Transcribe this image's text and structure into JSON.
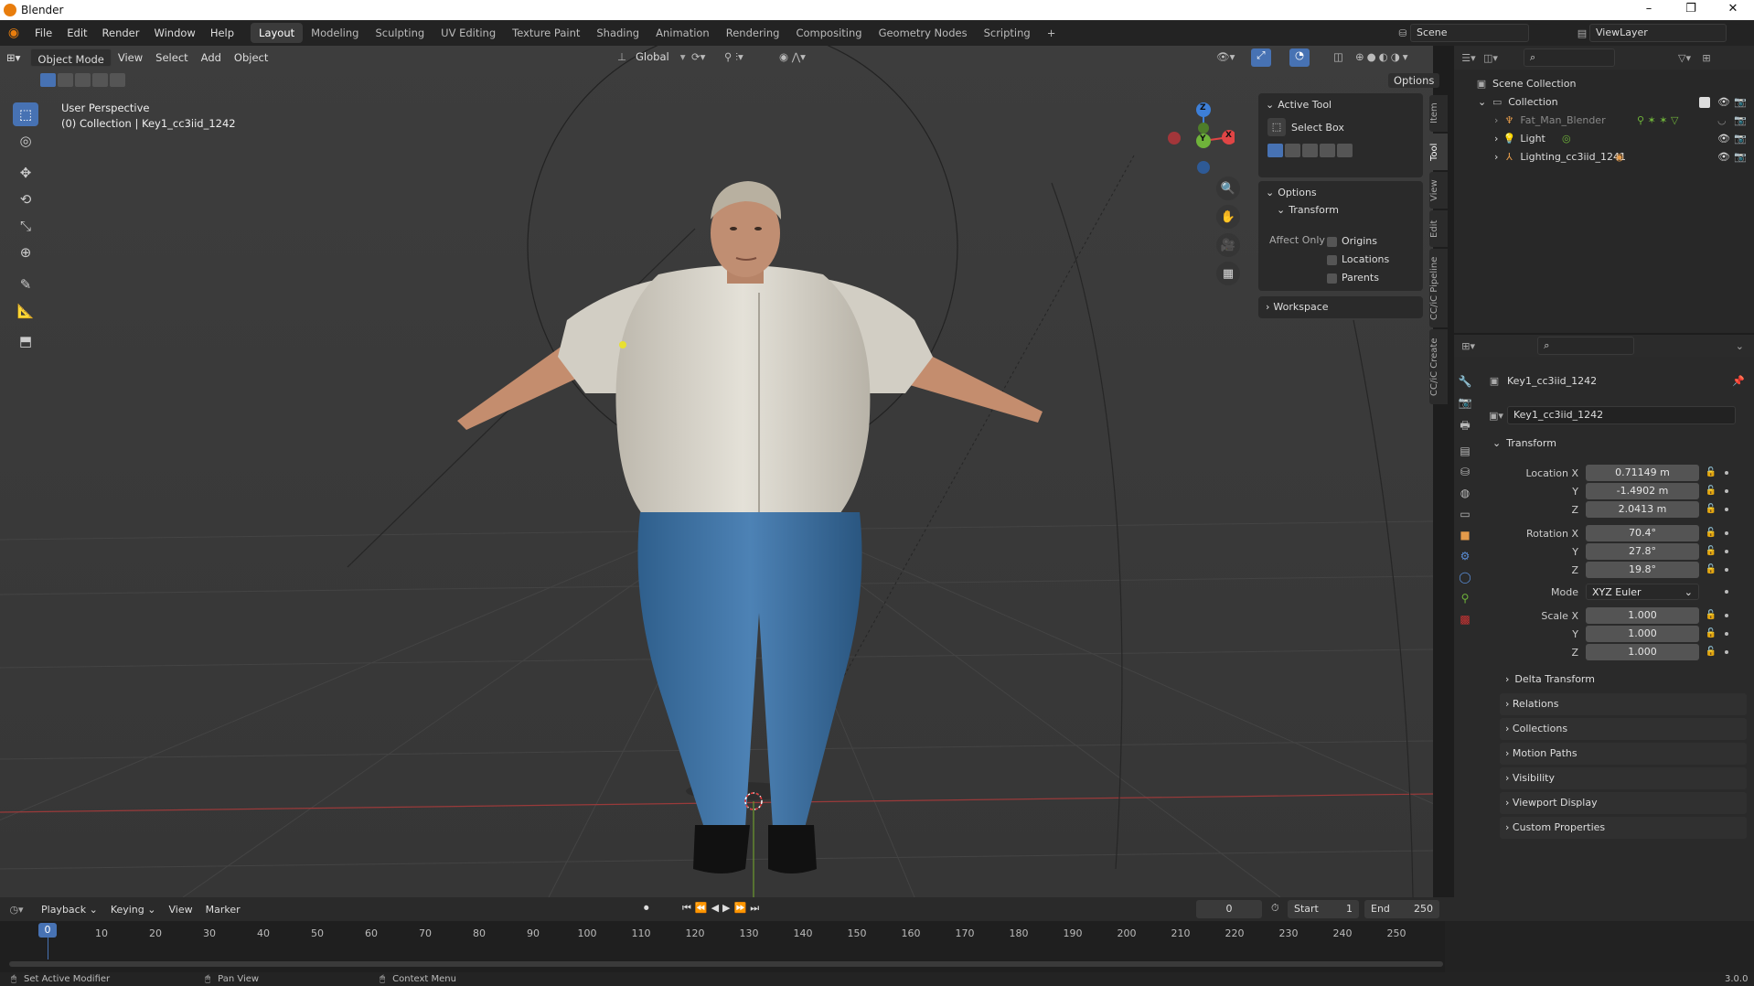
{
  "window": {
    "title": "Blender",
    "minimize": "–",
    "maximize": "❐",
    "close": "✕"
  },
  "menus": [
    "File",
    "Edit",
    "Render",
    "Window",
    "Help"
  ],
  "workspaces": [
    "Layout",
    "Modeling",
    "Sculpting",
    "UV Editing",
    "Texture Paint",
    "Shading",
    "Animation",
    "Rendering",
    "Compositing",
    "Geometry Nodes",
    "Scripting",
    "+"
  ],
  "scene": {
    "name": "Scene",
    "view_layer": "ViewLayer"
  },
  "viewport_header": {
    "mode": "Object Mode",
    "menus": [
      "View",
      "Select",
      "Add",
      "Object"
    ],
    "orientation": "Global",
    "options": "Options"
  },
  "viewport": {
    "perspective": "User Perspective",
    "collection_info": "(0) Collection | Key1_cc3iid_1242",
    "gizmo": {
      "x": "X",
      "y": "Y",
      "z": "Z",
      "x_color": "#e04545",
      "y_color": "#6fb33a",
      "z_color": "#3d7fd8"
    }
  },
  "tools": [
    "select-box",
    "cursor",
    "move",
    "rotate",
    "scale",
    "transform",
    "annotate",
    "measure",
    "add-cube"
  ],
  "n_panel": {
    "active_tool_title": "Active Tool",
    "tool_name": "Select Box",
    "options_title": "Options",
    "transform_title": "Transform",
    "affect_only": "Affect Only",
    "checks": [
      "Origins",
      "Locations",
      "Parents"
    ],
    "workspace_title": "Workspace",
    "tabs": [
      "Item",
      "Tool",
      "View",
      "Edit",
      "CC/iC Pipeline",
      "CC/iC Create"
    ]
  },
  "outliner": {
    "root": "Scene Collection",
    "collection": "Collection",
    "items": [
      "Fat_Man_Blender",
      "Light",
      "Lighting_cc3iid_1241"
    ]
  },
  "properties": {
    "object_name": "Key1_cc3iid_1242",
    "data_name": "Key1_cc3iid_1242",
    "transform_title": "Transform",
    "location": {
      "label": "Location X",
      "x": "0.71149 m",
      "y": "-1.4902 m",
      "z": "2.0413 m"
    },
    "rotation": {
      "label": "Rotation X",
      "x": "70.4°",
      "y": "27.8°",
      "z": "19.8°"
    },
    "mode_label": "Mode",
    "mode": "XYZ Euler",
    "scale": {
      "label": "Scale X",
      "x": "1.000",
      "y": "1.000",
      "z": "1.000"
    },
    "axis_y": "Y",
    "axis_z": "Z",
    "delta": "Delta Transform",
    "panels": [
      "Relations",
      "Collections",
      "Motion Paths",
      "Visibility",
      "Viewport Display",
      "Custom Properties"
    ]
  },
  "timeline": {
    "menus": [
      "Playback",
      "Keying",
      "View",
      "Marker"
    ],
    "current_frame": "0",
    "start_label": "Start",
    "start": "1",
    "end_label": "End",
    "end": "250",
    "ticks": [
      "10",
      "20",
      "30",
      "40",
      "50",
      "60",
      "70",
      "80",
      "90",
      "100",
      "110",
      "120",
      "130",
      "140",
      "150",
      "160",
      "170",
      "180",
      "190",
      "200",
      "210",
      "220",
      "230",
      "240",
      "250"
    ],
    "playhead": "0"
  },
  "status": {
    "left": "Set Active Modifier",
    "middle": "Pan View",
    "right": "Context Menu",
    "version": "3.0.0"
  }
}
